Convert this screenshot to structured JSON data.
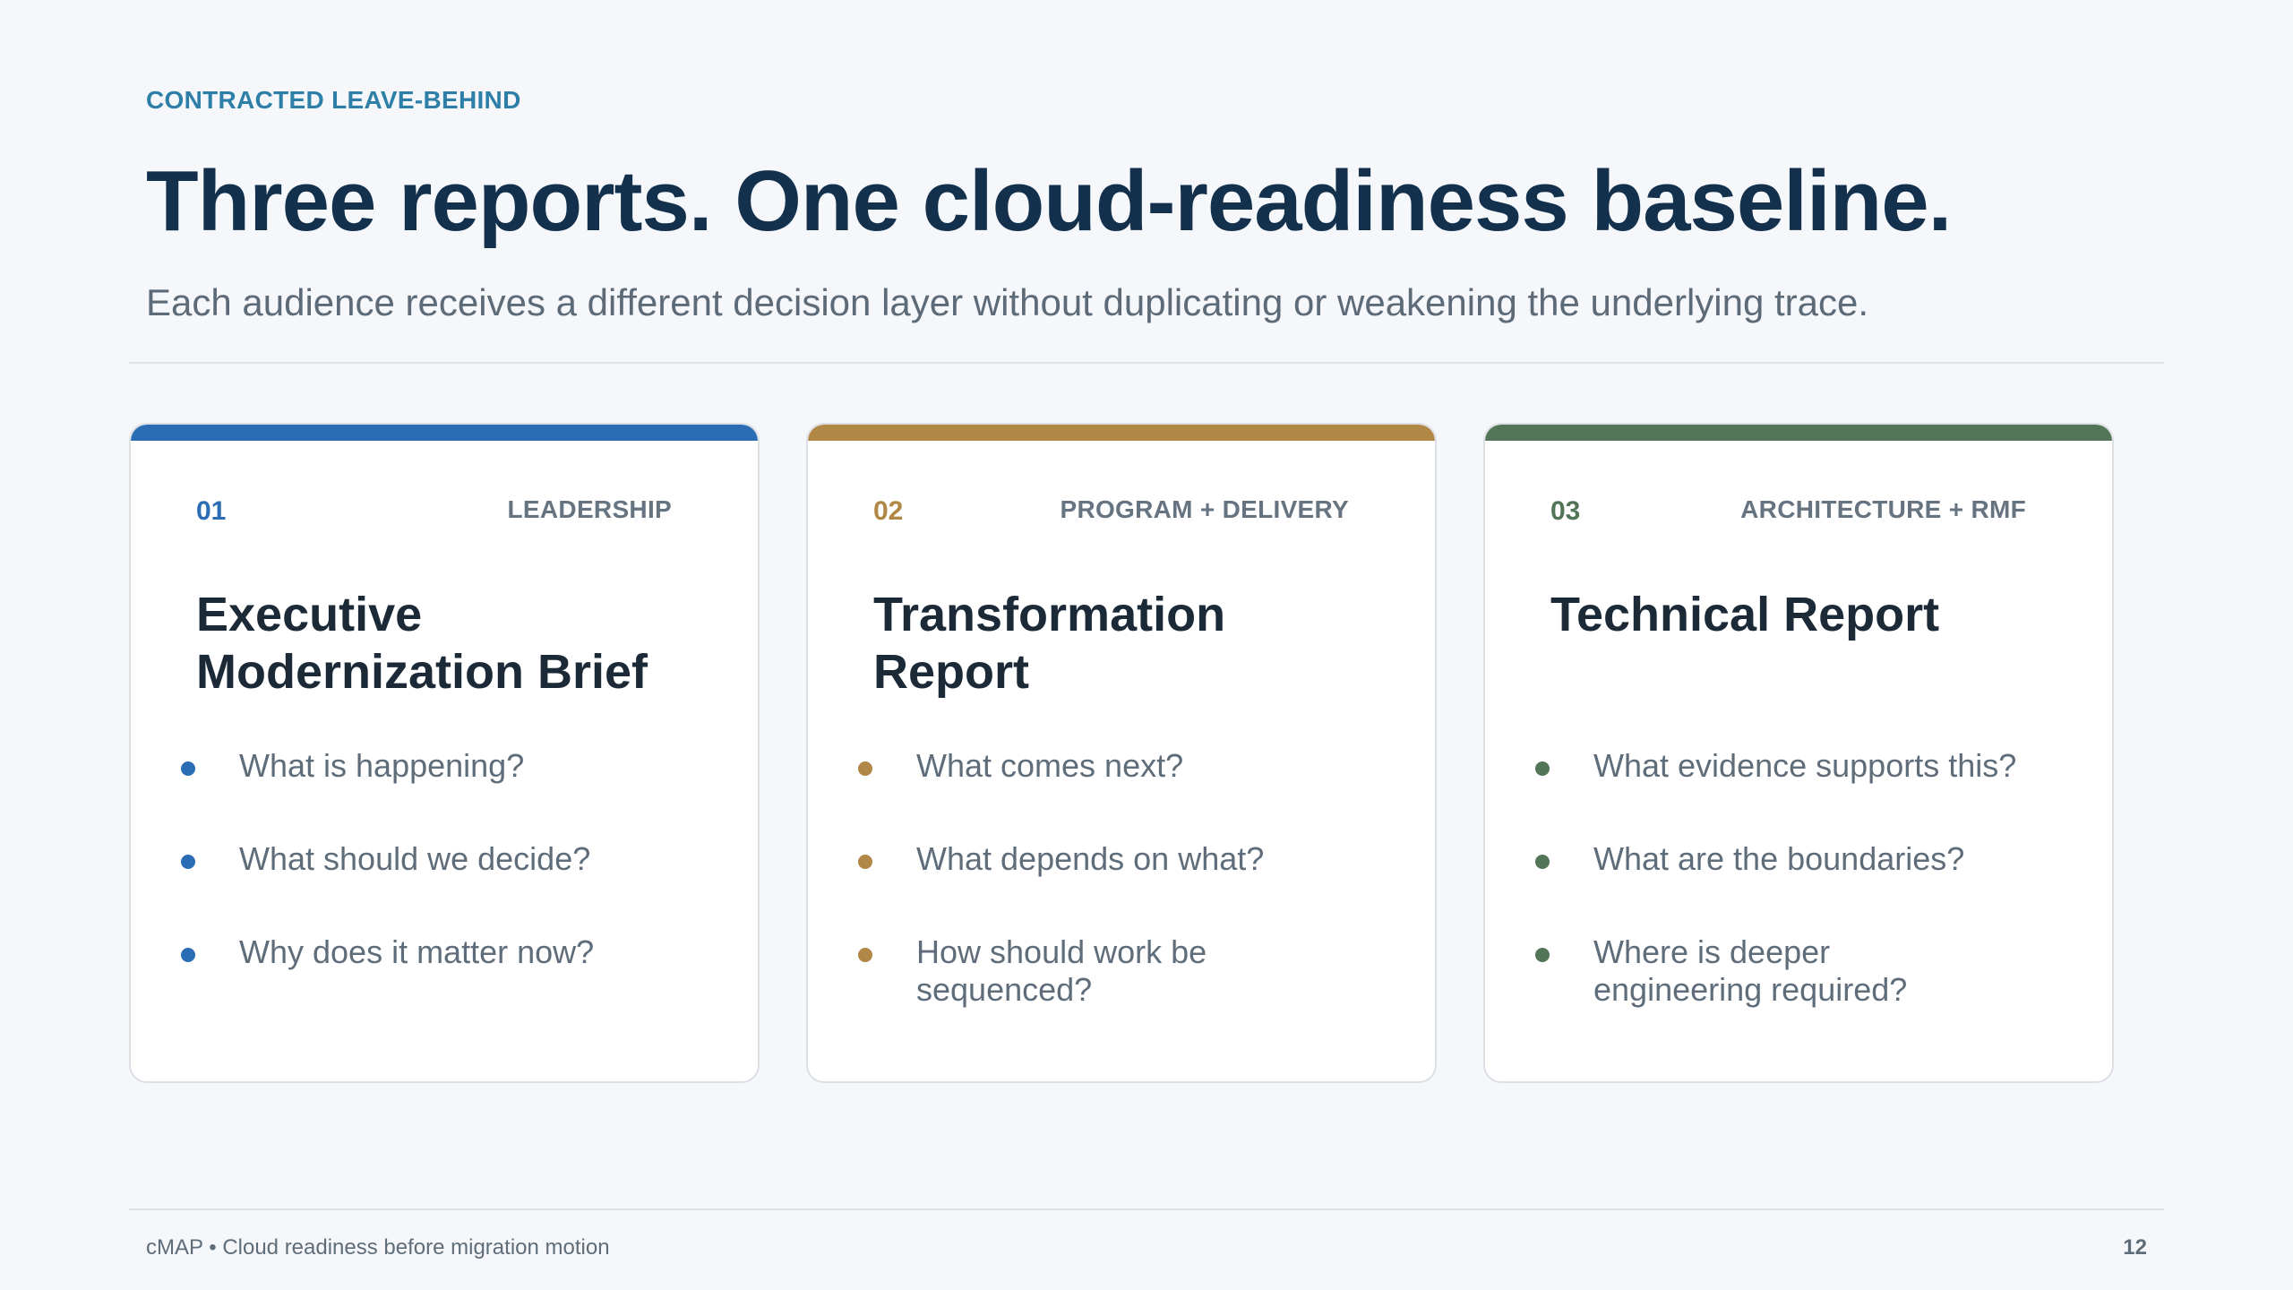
{
  "eyebrow": "CONTRACTED LEAVE-BEHIND",
  "title": "Three reports. One cloud-readiness baseline.",
  "subtitle": "Each audience receives a different decision layer without duplicating or weakening the underlying trace.",
  "cards": [
    {
      "number": "01",
      "audience": "LEADERSHIP",
      "heading": "Executive Modernization Brief",
      "accent": "#2a6db5",
      "items": [
        "What is happening?",
        "What should we decide?",
        "Why does it matter now?"
      ]
    },
    {
      "number": "02",
      "audience": "PROGRAM + DELIVERY",
      "heading": "Transformation Report",
      "accent": "#b08745",
      "items": [
        "What comes next?",
        "What depends on what?",
        "How should work be sequenced?"
      ]
    },
    {
      "number": "03",
      "audience": "ARCHITECTURE + RMF",
      "heading": "Technical Report",
      "accent": "#527457",
      "items": [
        "What evidence supports this?",
        "What are the boundaries?",
        "Where is deeper engineering required?"
      ]
    }
  ],
  "footer": {
    "left": "cMAP • Cloud readiness before migration motion",
    "page_number": "12"
  }
}
